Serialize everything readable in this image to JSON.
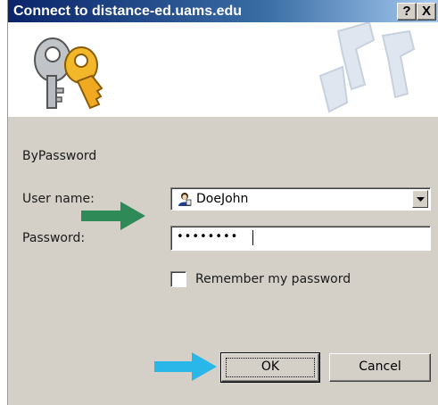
{
  "window": {
    "title": "Connect to distance-ed.uams.edu",
    "help_button": "?",
    "close_button": "X"
  },
  "form": {
    "auth_type": "ByPassword",
    "username_label": "User name:",
    "username_value": "DoeJohn",
    "password_label": "Password:",
    "password_value": "••••••••",
    "remember_label": "Remember my password",
    "remember_checked": false
  },
  "buttons": {
    "ok": "OK",
    "cancel": "Cancel"
  },
  "annotations": {
    "green_arrow_color": "#2e8b57",
    "blue_arrow_color": "#29b6e8"
  },
  "icons": {
    "banner": "keys-icon",
    "user": "user-icon",
    "dropdown": "chevron-down-icon"
  }
}
